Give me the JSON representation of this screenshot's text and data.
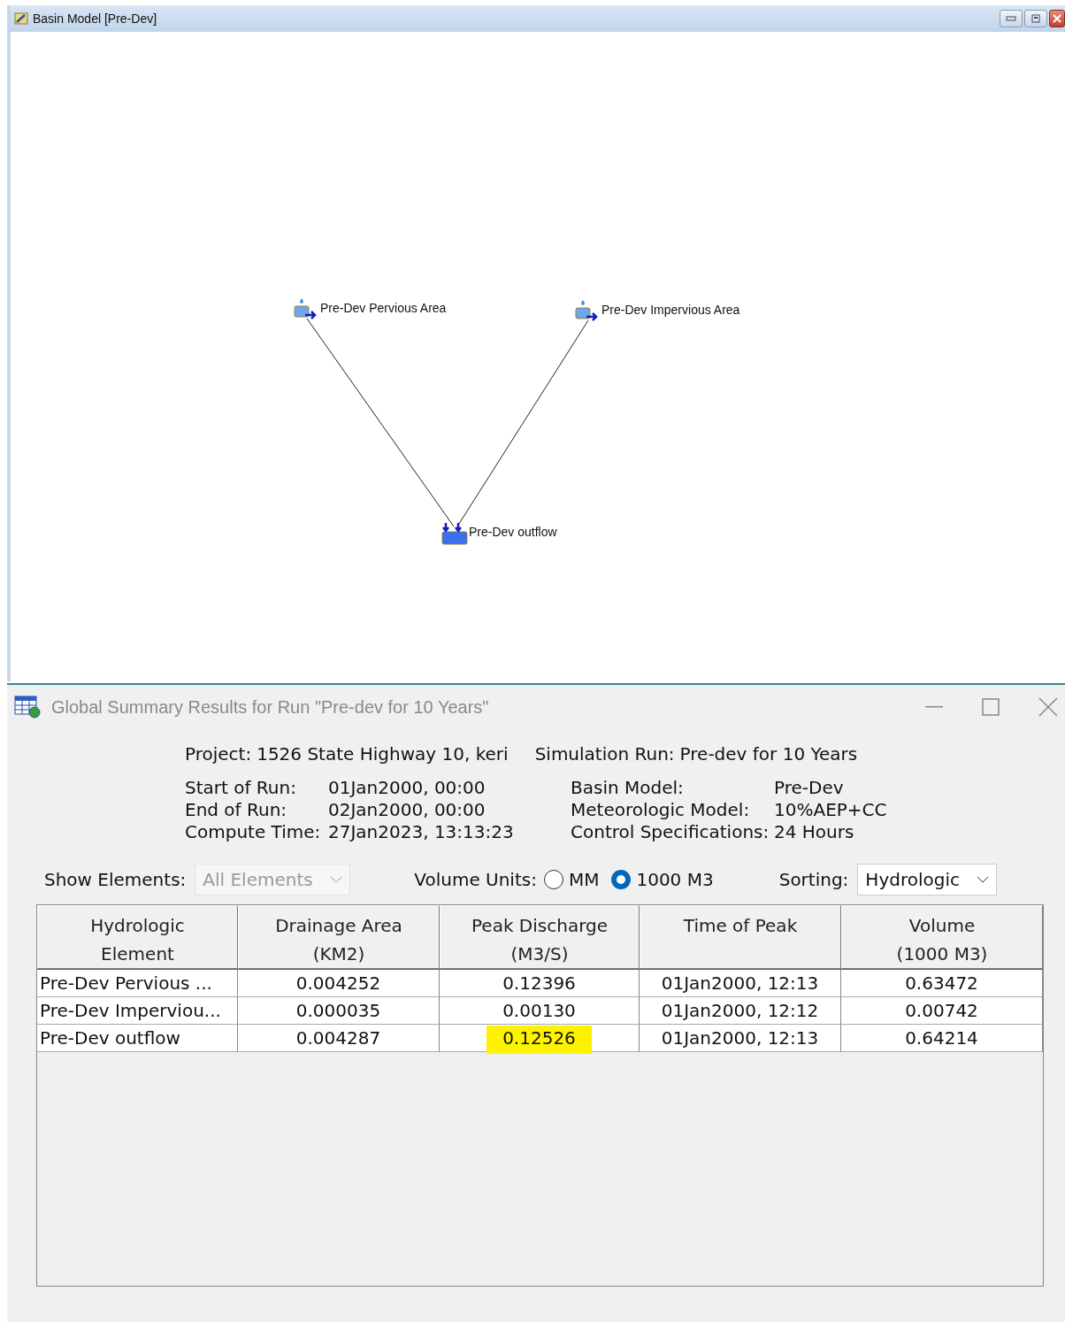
{
  "basin_window": {
    "title": "Basin Model [Pre-Dev]",
    "nodes": [
      {
        "kind": "subbasin",
        "label": "Pre-Dev Pervious Area"
      },
      {
        "kind": "subbasin",
        "label": "Pre-Dev Impervious Area"
      },
      {
        "kind": "junction",
        "label": "Pre-Dev outflow"
      }
    ]
  },
  "summary_window": {
    "title": "Global Summary Results for Run \"Pre-dev for 10 Years\"",
    "project": {
      "label": "Project:",
      "value": "1526 State Highway 10, keri"
    },
    "simulation_run": {
      "label": "Simulation Run:",
      "value": "Pre-dev for 10 Years"
    },
    "left_info": [
      {
        "label": "Start of Run:",
        "value": "01Jan2000, 00:00"
      },
      {
        "label": "End of Run:",
        "value": "02Jan2000, 00:00"
      },
      {
        "label": "Compute Time:",
        "value": "27Jan2023, 13:13:23"
      }
    ],
    "right_info": [
      {
        "label": "Basin Model:",
        "value": "Pre-Dev"
      },
      {
        "label": "Meteorologic Model:",
        "value": "10%AEP+CC"
      },
      {
        "label": "Control Specifications:",
        "value": "24 Hours"
      }
    ],
    "show_elements": {
      "label": "Show Elements:",
      "value": "All Elements",
      "disabled": true
    },
    "volume_units": {
      "label": "Volume Units:",
      "options": [
        {
          "label": "MM",
          "selected": false
        },
        {
          "label": "1000 M3",
          "selected": true
        }
      ]
    },
    "sorting": {
      "label": "Sorting:",
      "value": "Hydrologic",
      "disabled": false
    },
    "table": {
      "columns": [
        "Hydrologic\nElement",
        "Drainage Area\n(KM2)",
        "Peak Discharge\n(M3/S)",
        "Time of Peak",
        "Volume\n(1000 M3)"
      ],
      "rows": [
        [
          {
            "text": "Pre-Dev Pervious ...",
            "highlighted": false
          },
          {
            "text": "0.004252",
            "highlighted": false
          },
          {
            "text": "0.12396",
            "highlighted": false
          },
          {
            "text": "01Jan2000, 12:13",
            "highlighted": false
          },
          {
            "text": "0.63472",
            "highlighted": false
          }
        ],
        [
          {
            "text": "Pre-Dev Imperviou...",
            "highlighted": false
          },
          {
            "text": "0.000035",
            "highlighted": false
          },
          {
            "text": "0.00130",
            "highlighted": false
          },
          {
            "text": "01Jan2000, 12:12",
            "highlighted": false
          },
          {
            "text": "0.00742",
            "highlighted": false
          }
        ],
        [
          {
            "text": "Pre-Dev outflow",
            "highlighted": false
          },
          {
            "text": "0.004287",
            "highlighted": false
          },
          {
            "text": "0.12526",
            "highlighted": true
          },
          {
            "text": "01Jan2000, 12:13",
            "highlighted": false
          },
          {
            "text": "0.64214",
            "highlighted": false
          }
        ]
      ]
    }
  }
}
